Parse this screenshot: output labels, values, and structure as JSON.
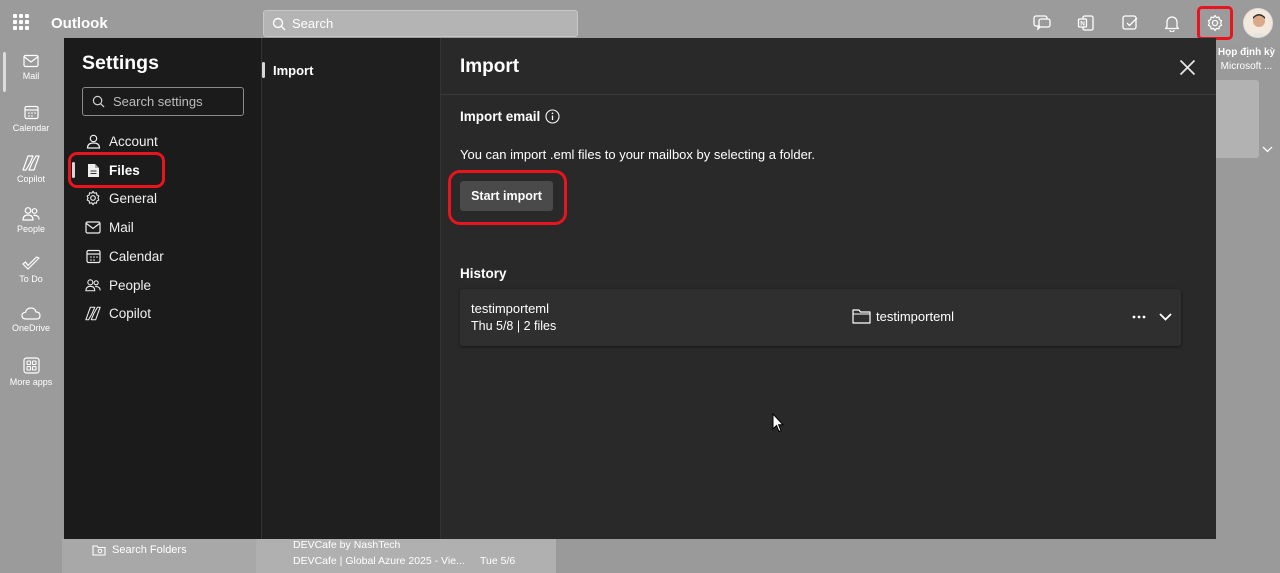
{
  "app": {
    "title": "Outlook",
    "search_placeholder": "Search"
  },
  "left_rail": [
    {
      "label": "Mail",
      "icon": "mail-icon"
    },
    {
      "label": "Calendar",
      "icon": "calendar-icon"
    },
    {
      "label": "Copilot",
      "icon": "copilot-icon"
    },
    {
      "label": "People",
      "icon": "people-icon"
    },
    {
      "label": "To Do",
      "icon": "todo-icon"
    },
    {
      "label": "OneDrive",
      "icon": "onedrive-icon"
    },
    {
      "label": "More apps",
      "icon": "more-apps-icon"
    }
  ],
  "background": {
    "meeting_line1": "Họp định kỳ",
    "meeting_line2": "Microsoft ...",
    "search_folders": "Search Folders",
    "mail_sender": "DEVCafe by NashTech",
    "mail_subject": "DEVCafe | Global Azure 2025 - Vie...",
    "mail_date": "Tue 5/6"
  },
  "settings": {
    "title": "Settings",
    "search_placeholder": "Search settings",
    "nav": [
      {
        "label": "Account",
        "icon": "account-icon"
      },
      {
        "label": "Files",
        "icon": "file-icon",
        "active": true
      },
      {
        "label": "General",
        "icon": "gear-icon"
      },
      {
        "label": "Mail",
        "icon": "mail-icon"
      },
      {
        "label": "Calendar",
        "icon": "calendar-icon"
      },
      {
        "label": "People",
        "icon": "people-icon"
      },
      {
        "label": "Copilot",
        "icon": "copilot-icon"
      }
    ],
    "subnav": {
      "import": "Import"
    }
  },
  "content": {
    "title": "Import",
    "import_email_heading": "Import email",
    "import_description": "You can import .eml files to your mailbox by selecting a folder.",
    "start_import_label": "Start import",
    "history_heading": "History",
    "history": [
      {
        "name": "testimporteml",
        "meta": "Thu 5/8 | 2 files",
        "folder": "testimporteml"
      }
    ]
  },
  "colors": {
    "highlight": "#e8141e",
    "dialog_bg": "#1f1f1f",
    "content_bg": "#292929",
    "button_bg": "#4a4a4a"
  }
}
